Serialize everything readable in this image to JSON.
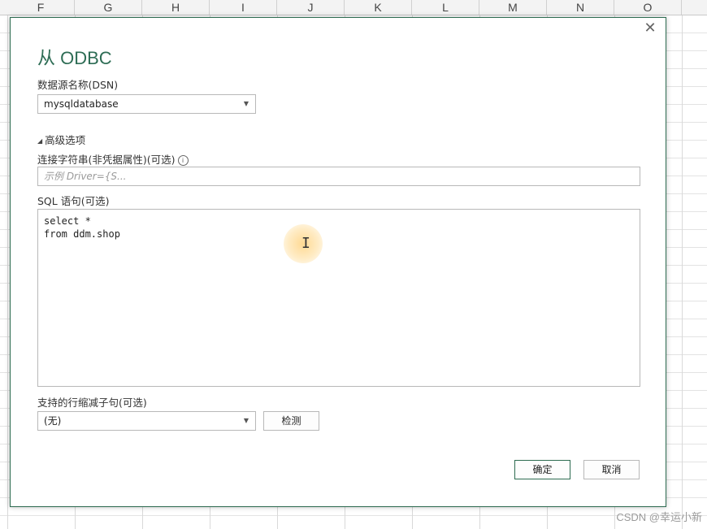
{
  "sheet": {
    "columns": [
      "F",
      "G",
      "H",
      "I",
      "J",
      "K",
      "L",
      "M",
      "N",
      "O"
    ]
  },
  "dialog": {
    "title": "从 ODBC",
    "close_icon": "close-icon",
    "dsn_label": "数据源名称(DSN)",
    "dsn_value": "mysqldatabase",
    "advanced_toggle": "高级选项",
    "conn_string_label": "连接字符串(非凭据属性)(可选)",
    "conn_string_placeholder": "示例 Driver={S...",
    "sql_label": "SQL 语句(可选)",
    "sql_lines": [
      "select *",
      "from ddm.shop"
    ],
    "reduction_label": "支持的行缩减子句(可选)",
    "reduction_value": "(无)",
    "detect_button": "检测",
    "ok_button": "确定",
    "cancel_button": "取消",
    "accent_color": "#2e6d55"
  },
  "watermark": "CSDN @幸运小新"
}
